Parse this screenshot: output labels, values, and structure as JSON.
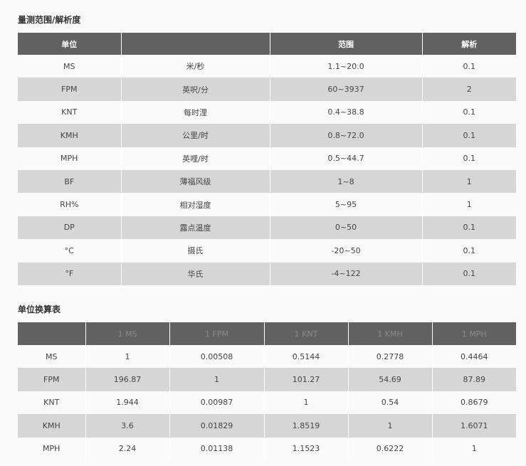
{
  "section1": {
    "title": "量测范围/解析度",
    "headers": [
      "单位",
      "",
      "范围",
      "解析"
    ],
    "rows": [
      {
        "unit": "MS",
        "name": "米/秒",
        "range": "1.1~20.0",
        "res": "0.1"
      },
      {
        "unit": "FPM",
        "name": "英呎/分",
        "range": "60~3937",
        "res": "2"
      },
      {
        "unit": "KNT",
        "name": "每时浬",
        "range": "0.4~38.8",
        "res": "0.1"
      },
      {
        "unit": "KMH",
        "name": "公里/时",
        "range": "0.8~72.0",
        "res": "0.1"
      },
      {
        "unit": "MPH",
        "name": "英哩/时",
        "range": "0.5~44.7",
        "res": "0.1"
      },
      {
        "unit": "BF",
        "name": "薄福风级",
        "range": "1~8",
        "res": "1"
      },
      {
        "unit": "RH%",
        "name": "相对湿度",
        "range": "5~95",
        "res": "1"
      },
      {
        "unit": "DP",
        "name": "露点温度",
        "range": "0~50",
        "res": "0.1"
      },
      {
        "unit": "°C",
        "name": "摄氏",
        "range": "-20~50",
        "res": "0.1"
      },
      {
        "unit": "°F",
        "name": "华氏",
        "range": "-4~122",
        "res": "0.1"
      }
    ]
  },
  "section2": {
    "title": "单位换算表",
    "headers": [
      "",
      "1 MS",
      "1 FPM",
      "1 KNT",
      "1 KMH",
      "1 MPH"
    ],
    "rows": [
      [
        "MS",
        "1",
        "0.00508",
        "0.5144",
        "0.2778",
        "0.4464"
      ],
      [
        "FPM",
        "196.87",
        "1",
        "101.27",
        "54.69",
        "87.89"
      ],
      [
        "KNT",
        "1.944",
        "0.00987",
        "1",
        "0.54",
        "0.8679"
      ],
      [
        "KMH",
        "3.6",
        "0.01829",
        "1.8519",
        "1",
        "1.6071"
      ],
      [
        "MPH",
        "2.24",
        "0.01138",
        "1.1523",
        "0.6222",
        "1"
      ]
    ]
  },
  "colors": {
    "header_bg": "#616161",
    "stripe_bg": "#d6d6d6",
    "page_bg": "#fafafa"
  }
}
